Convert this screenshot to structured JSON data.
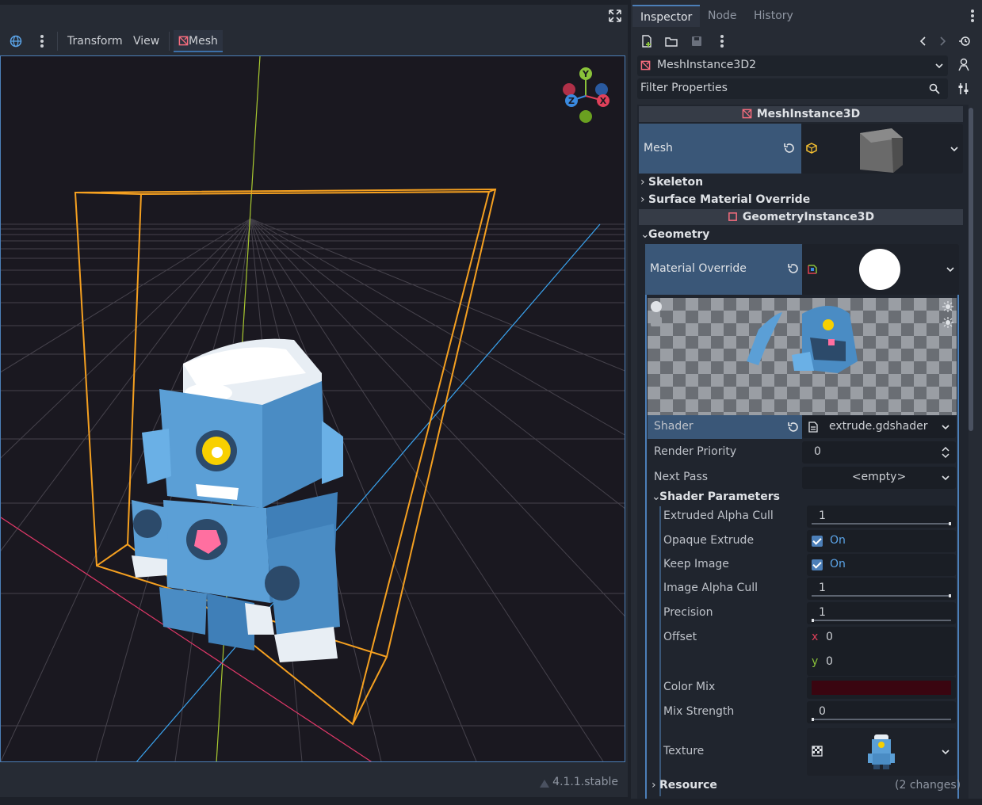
{
  "viewport": {
    "toolbar": {
      "transform_label": "Transform",
      "view_label": "View",
      "mesh_label": "Mesh"
    },
    "gizmo": {
      "y": "Y",
      "x": "X",
      "z": "Z"
    },
    "version": "4.1.1.stable"
  },
  "inspector": {
    "tabs": {
      "inspector": "Inspector",
      "node": "Node",
      "history": "History"
    },
    "node_name": "MeshInstance3D2",
    "filter_placeholder": "Filter Properties",
    "mesh_instance_header": "MeshInstance3D",
    "mesh_label": "Mesh",
    "skeleton_label": "Skeleton",
    "surface_override_label": "Surface Material Override",
    "geometry_instance_header": "GeometryInstance3D",
    "geometry_label": "Geometry",
    "material_override_label": "Material Override",
    "shader_label": "Shader",
    "shader_value": "extrude.gdshader",
    "render_priority_label": "Render Priority",
    "render_priority_value": "0",
    "next_pass_label": "Next Pass",
    "next_pass_value": "<empty>",
    "shader_params_label": "Shader Parameters",
    "params": {
      "extruded_alpha_cull_label": "Extruded Alpha Cull",
      "extruded_alpha_cull_value": "1",
      "opaque_extrude_label": "Opaque Extrude",
      "opaque_extrude_value": "On",
      "keep_image_label": "Keep Image",
      "keep_image_value": "On",
      "image_alpha_cull_label": "Image Alpha Cull",
      "image_alpha_cull_value": "1",
      "precision_label": "Precision",
      "precision_value": "1",
      "offset_label": "Offset",
      "offset_x_label": "x",
      "offset_x_value": "0",
      "offset_y_label": "y",
      "offset_y_value": "0",
      "color_mix_label": "Color Mix",
      "color_mix_color": "#3a0510",
      "mix_strength_label": "Mix Strength",
      "mix_strength_value": "0",
      "texture_label": "Texture"
    },
    "resource_label": "Resource",
    "changes": "(2 changes)"
  },
  "colors": {
    "accent": "#4c7fb8",
    "selection_orange": "#f5a020",
    "robot_blue": "#5b9fd6"
  }
}
